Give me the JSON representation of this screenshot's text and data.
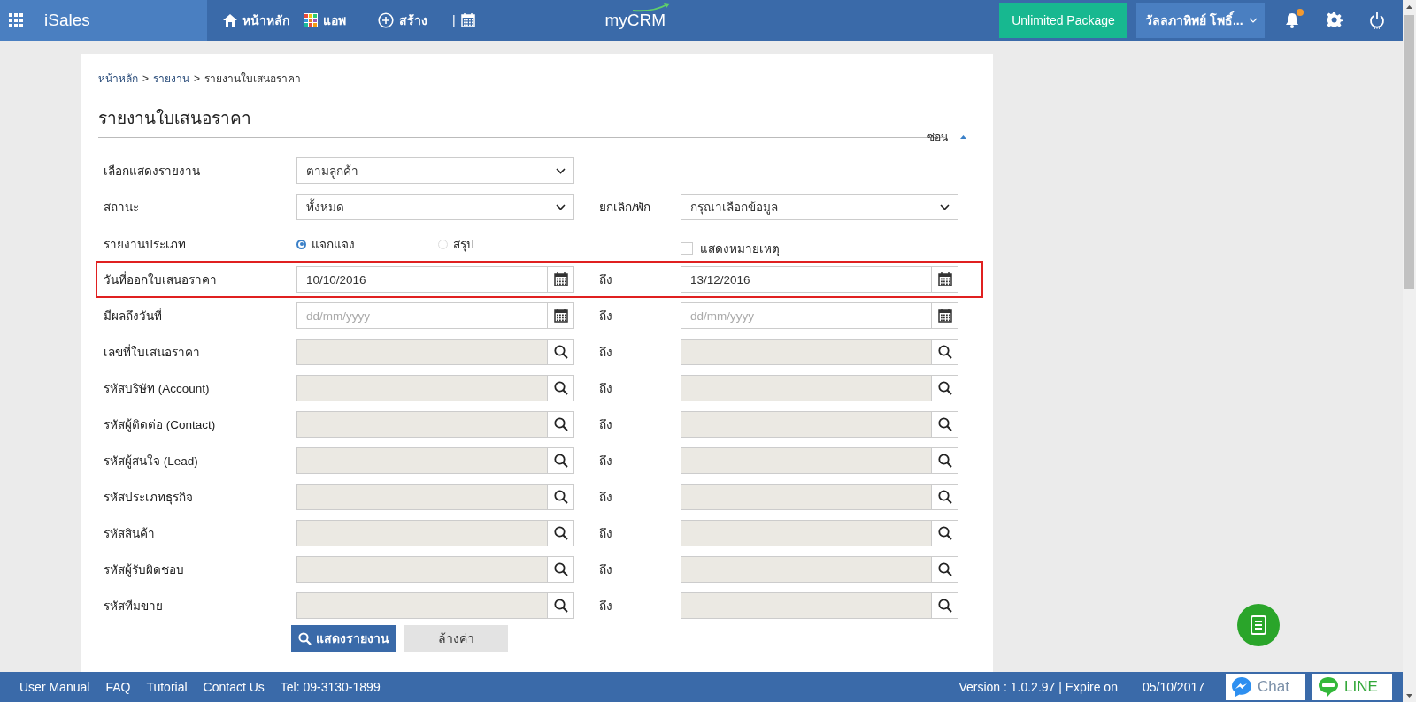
{
  "header": {
    "app_name": "iSales",
    "nav": [
      {
        "kind": "home",
        "label": "หน้าหลัก"
      },
      {
        "kind": "apps",
        "label": "แอพ"
      },
      {
        "kind": "create",
        "label": "สร้าง"
      }
    ],
    "separator": "|",
    "logo": "myCRM",
    "package": "Unlimited Package",
    "user": "วัลลภาทิพย์ โพธิ์...",
    "notification_badge": true
  },
  "breadcrumb": {
    "items": [
      "หน้าหลัก",
      "รายงาน",
      "รายงานใบเสนอราคา"
    ],
    "separator": ">"
  },
  "title": "รายงานใบเสนอราคา",
  "hide_toggle": "ซ่อน",
  "form": {
    "rows": [
      {
        "kind": "select",
        "label": "เลือกแสดงรายงาน",
        "from": {
          "value": "ตามลูกค้า"
        }
      },
      {
        "kind": "select",
        "label": "สถานะ",
        "from": {
          "value": "ทั้งหมด"
        },
        "to_label": "ยกเลิก/พัก",
        "to": {
          "value": "กรุณาเลือกข้อมูล"
        }
      },
      {
        "kind": "radio",
        "label": "รายงานประเภท",
        "options": [
          {
            "label": "แจกแจง",
            "selected": true
          },
          {
            "label": "สรุป",
            "selected": false
          }
        ],
        "checkbox": {
          "label": "แสดงหมายเหตุ",
          "checked": false
        }
      },
      {
        "kind": "date",
        "label": "วันที่ออกใบเสนอราคา",
        "highlighted": true,
        "from": {
          "value": "10/10/2016"
        },
        "to_label": "ถึง",
        "to": {
          "value": "13/12/2016"
        }
      },
      {
        "kind": "date",
        "label": "มีผลถึงวันที่",
        "highlighted": false,
        "from": {
          "placeholder": "dd/mm/yyyy"
        },
        "to_label": "ถึง",
        "to": {
          "placeholder": "dd/mm/yyyy"
        }
      },
      {
        "kind": "lookup",
        "label": "เลขที่ใบเสนอราคา",
        "to_label": "ถึง"
      },
      {
        "kind": "lookup",
        "label": "รหัสบริษัท (Account)",
        "to_label": "ถึง"
      },
      {
        "kind": "lookup",
        "label": "รหัสผู้ติดต่อ (Contact)",
        "to_label": "ถึง"
      },
      {
        "kind": "lookup",
        "label": "รหัสผู้สนใจ (Lead)",
        "to_label": "ถึง"
      },
      {
        "kind": "lookup",
        "label": "รหัสประเภทธุรกิจ",
        "to_label": "ถึง"
      },
      {
        "kind": "lookup",
        "label": "รหัสสินค้า",
        "to_label": "ถึง"
      },
      {
        "kind": "lookup",
        "label": "รหัสผู้รับผิดชอบ",
        "to_label": "ถึง"
      },
      {
        "kind": "lookup",
        "label": "รหัสทีมขาย",
        "to_label": "ถึง"
      }
    ],
    "submit": "แสดงรายงาน",
    "clear": "ล้างค่า"
  },
  "footer": {
    "links": [
      "User Manual",
      "FAQ",
      "Tutorial",
      "Contact Us"
    ],
    "phone": "Tel: 09-3130-1899",
    "version": "Version : 1.0.2.97 | Expire on",
    "expire_date": "05/10/2017",
    "chat": "Chat",
    "line": "LINE"
  }
}
